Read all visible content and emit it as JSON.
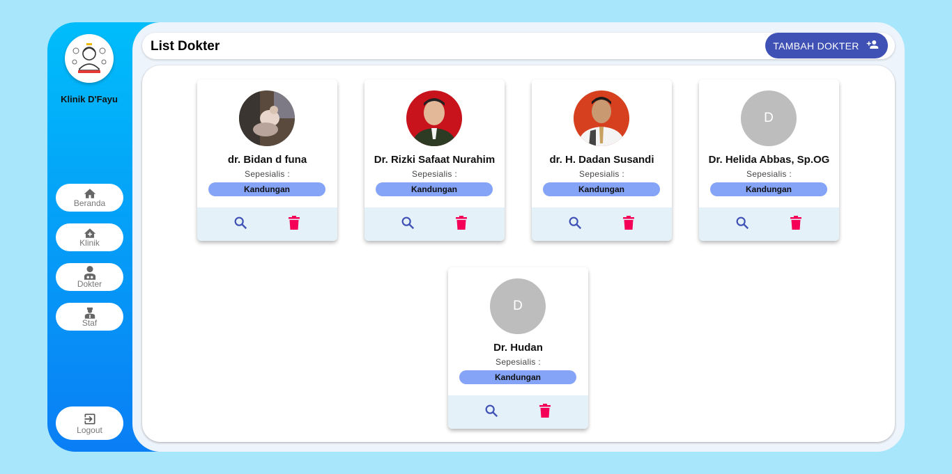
{
  "sidebar": {
    "clinic_name": "Klinik D'Fayu",
    "nav": [
      {
        "label": "Beranda",
        "icon": "home-icon"
      },
      {
        "label": "Klinik",
        "icon": "clinic-icon"
      },
      {
        "label": "Dokter",
        "icon": "doctor-icon"
      },
      {
        "label": "Staf",
        "icon": "staff-icon"
      }
    ],
    "logout_label": "Logout"
  },
  "header": {
    "title": "List Dokter",
    "add_button_label": "TAMBAH DOKTER"
  },
  "doctors": [
    {
      "name": "dr. Bidan d funa",
      "spec_label": "Sepesialis :",
      "specialty": "Kandungan",
      "initial": ""
    },
    {
      "name": "Dr. Rizki Safaat Nurahim",
      "spec_label": "Sepesialis :",
      "specialty": "Kandungan",
      "initial": ""
    },
    {
      "name": "dr. H. Dadan Susandi",
      "spec_label": "Sepesialis :",
      "specialty": "Kandungan",
      "initial": ""
    },
    {
      "name": "Dr. Helida Abbas, Sp.OG",
      "spec_label": "Sepesialis :",
      "specialty": "Kandungan",
      "initial": "D"
    },
    {
      "name": "Dr. Hudan",
      "spec_label": "Sepesialis :",
      "specialty": "Kandungan",
      "initial": "D"
    }
  ],
  "colors": {
    "background": "#a8e6fc",
    "sidebar_top": "#00bdfa",
    "sidebar_bottom": "#0a7ef5",
    "primary": "#3f51b5",
    "chip": "#85a3f7",
    "delete": "#f50057"
  }
}
